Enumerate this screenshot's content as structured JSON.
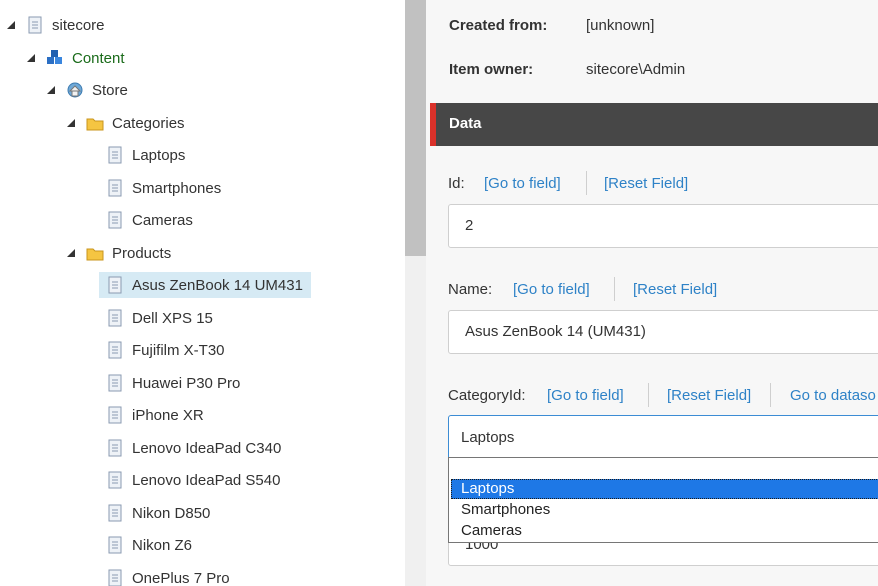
{
  "tree": {
    "root": "sitecore",
    "content": "Content",
    "store": "Store",
    "categories": "Categories",
    "category_items": [
      "Laptops",
      "Smartphones",
      "Cameras"
    ],
    "products": "Products",
    "product_items": [
      "Asus ZenBook 14 UM431",
      "Dell XPS 15",
      "Fujifilm X-T30",
      "Huawei P30 Pro",
      "iPhone XR",
      "Lenovo IdeaPad C340",
      "Lenovo IdeaPad S540",
      "Nikon D850",
      "Nikon Z6",
      "OnePlus 7 Pro"
    ],
    "selected": "Asus ZenBook 14 UM431"
  },
  "meta": {
    "created_from_label": "Created from:",
    "created_from_value": "[unknown]",
    "owner_label": "Item owner:",
    "owner_value": "sitecore\\Admin"
  },
  "section": {
    "title": "Data"
  },
  "fields": {
    "go_to_field": "[Go to field]",
    "reset_field": "[Reset Field]",
    "go_to_datasource": "Go to dataso",
    "id": {
      "label": "Id:",
      "value": "2"
    },
    "name": {
      "label": "Name:",
      "value": "Asus ZenBook 14 (UM431)"
    },
    "category": {
      "label": "CategoryId:",
      "value": "Laptops",
      "options": [
        "",
        "Laptops",
        "Smartphones",
        "Cameras"
      ]
    },
    "price": {
      "value": "1000"
    }
  },
  "colors": {
    "link": "#2e82c7",
    "section_bg": "#474747",
    "section_accent": "#d9312a",
    "selection": "#1e78e6",
    "tree_selected": "#d6eaf4"
  }
}
